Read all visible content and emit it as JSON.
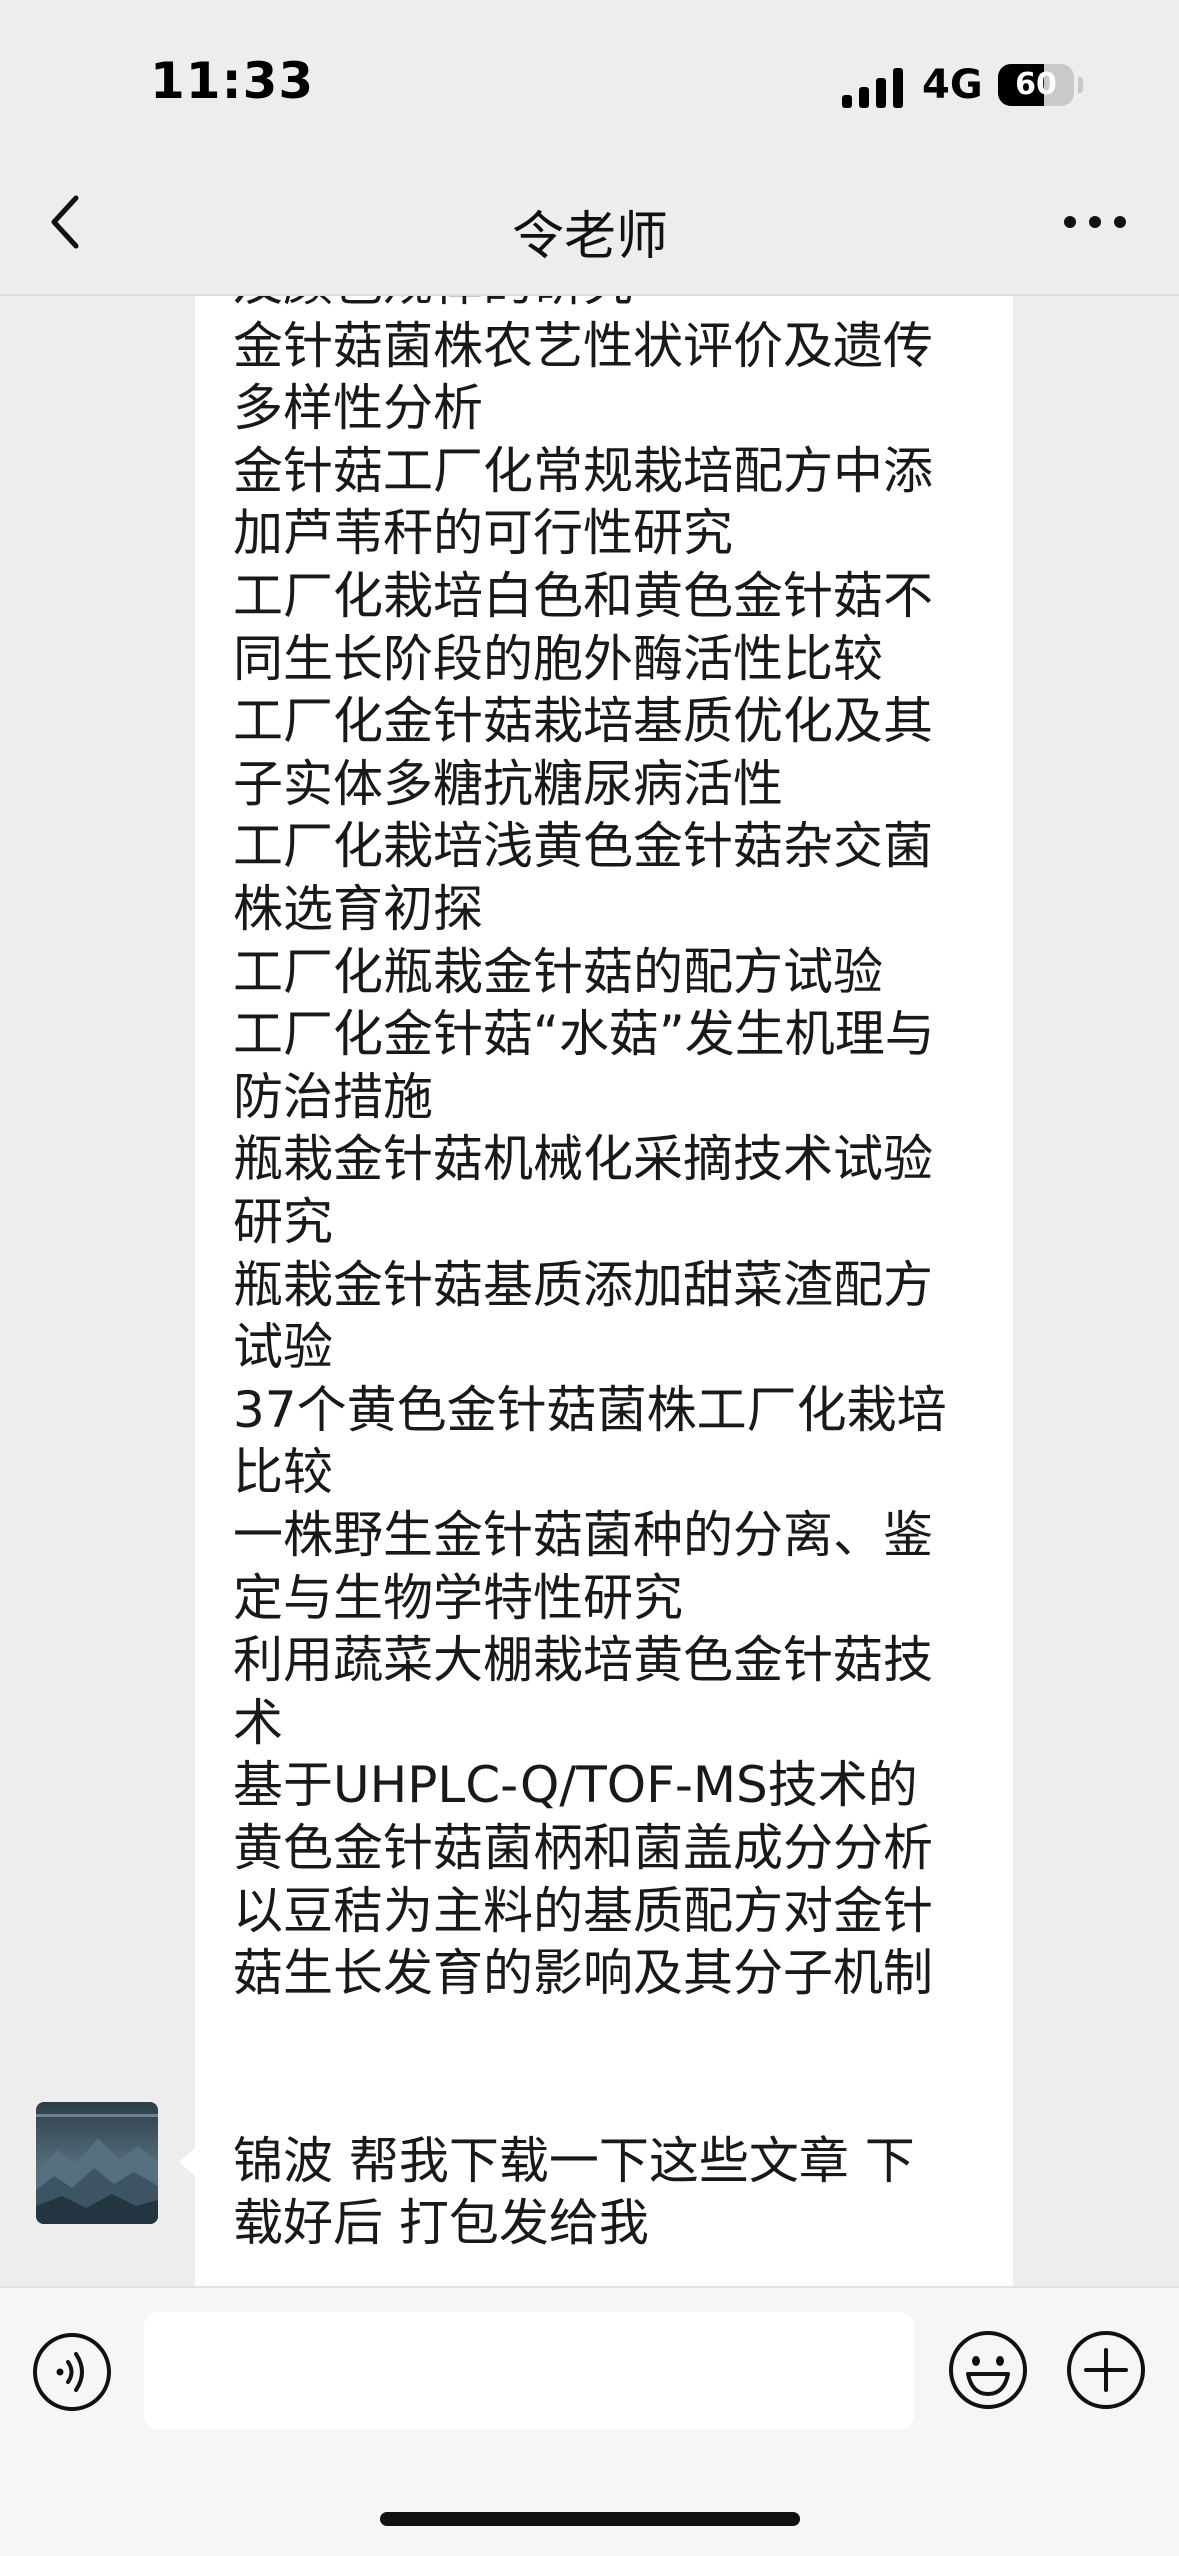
{
  "status_bar": {
    "time": "11:33",
    "network": "4G",
    "battery": "60",
    "battery_level": 0.6,
    "signal_bars_active": 3,
    "signal_bars_total": 4
  },
  "header": {
    "title": "令老师",
    "back_icon": "chevron-left-icon",
    "more_icon": "more-dots-icon"
  },
  "messages": [
    {
      "sender": "other",
      "lines": [
        "及颜色规律的研究",
        "金针菇菌株农艺性状评价及遗传",
        "多样性分析",
        "金针菇工厂化常规栽培配方中添",
        "加芦苇秆的可行性研究",
        "工厂化栽培白色和黄色金针菇不",
        "同生长阶段的胞外酶活性比较",
        "工厂化金针菇栽培基质优化及其",
        "子实体多糖抗糖尿病活性",
        "工厂化栽培浅黄色金针菇杂交菌",
        "株选育初探",
        "工厂化瓶栽金针菇的配方试验",
        "工厂化金针菇“水菇”发生机理与",
        "防治措施",
        "瓶栽金针菇机械化采摘技术试验",
        "研究",
        "瓶栽金针菇基质添加甜菜渣配方",
        "试验",
        "37个黄色金针菇菌株工厂化栽培",
        "比较",
        "一株野生金针菇菌种的分离、鉴",
        "定与生物学特性研究",
        "利用蔬菜大棚栽培黄色金针菇技",
        "术",
        "基于UHPLC-Q/TOF-MS技术的",
        "黄色金针菇菌柄和菌盖成分分析",
        "以豆秸为主料的基质配方对金针",
        "菇生长发育的影响及其分子机制"
      ]
    },
    {
      "sender": "other",
      "avatar_icon": "mountain-landscape-avatar",
      "lines": [
        "锦波  帮我下载一下这些文章 下",
        "载好后 打包发给我"
      ]
    }
  ],
  "input_bar": {
    "value": "",
    "voice_icon": "voice-icon",
    "emoji_icon": "emoji-icon",
    "plus_icon": "plus-icon"
  },
  "colors": {
    "background": "#ededed",
    "bubble": "#ffffff",
    "text": "#191919",
    "input_bar": "#f6f6f6"
  }
}
